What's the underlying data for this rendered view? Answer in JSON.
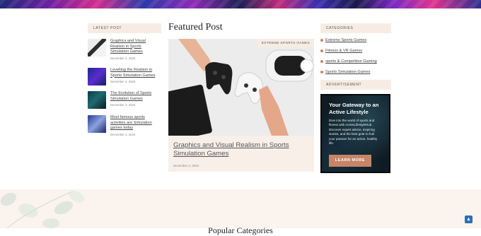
{
  "latest": {
    "heading": "LATEST POST",
    "posts": [
      {
        "title_lines": [
          "Graphics and Visual",
          "Realism in Sports",
          "Simulation Games"
        ],
        "date": "December 4, 2024"
      },
      {
        "title_lines": [
          "Levelling the Realism in",
          "Sports Simulation Games"
        ],
        "date": "December 4, 2024"
      },
      {
        "title_lines": [
          "The Evolution of Sports",
          "Simulation Games"
        ],
        "date": "December 4, 2024"
      },
      {
        "title_lines": [
          "Most famous sports",
          "activities are Simulation",
          "games today"
        ],
        "date": "December 4, 2024"
      }
    ]
  },
  "featured": {
    "heading": "Featured Post",
    "badge": "EXTREME SPORTS GAMES",
    "title_lines": [
      "Graphics and Visual Realism in Sports",
      "Simulation Games"
    ],
    "date": "December 4, 2024"
  },
  "categories": {
    "heading": "CATEGORIES",
    "items": [
      "Extreme Sports Games",
      "Fitness & VR Games",
      "sports & Competitive Gaming",
      "Sports Simulation Games"
    ]
  },
  "ad": {
    "heading": "ADVERTISEMENT",
    "headline_lines": [
      "Your Gateway to an",
      "Active Lifestyle"
    ],
    "body_lines": [
      "Dive into the world of sports and",
      "fitness with ActiveLifestyleHub.",
      "Discover expert advice, inspiring",
      "stories, and the best gear to fuel",
      "your passion for an active, healthy",
      "life."
    ],
    "cta": "LEARN MORE"
  },
  "footer": {
    "popular_heading": "Popular Categories"
  },
  "scroll_top_icon": "chevron-up-icon"
}
